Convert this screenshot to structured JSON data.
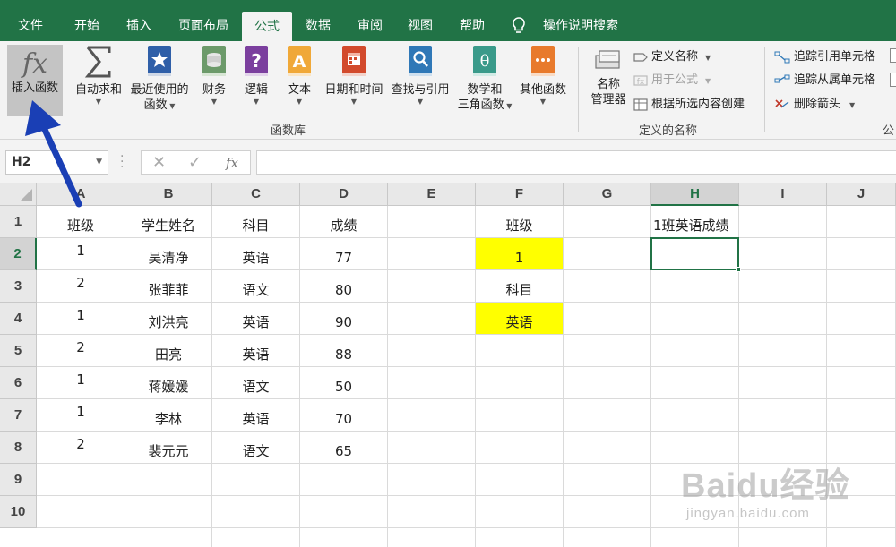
{
  "menu": {
    "tabs": [
      "文件",
      "开始",
      "插入",
      "页面布局",
      "公式",
      "数据",
      "审阅",
      "视图",
      "帮助"
    ],
    "active_tab": "公式",
    "search_label": "操作说明搜索"
  },
  "ribbon": {
    "insert_function": "插入函数",
    "function_library": {
      "buttons": [
        {
          "line1": "自动求和",
          "line2": ""
        },
        {
          "line1": "最近使用的",
          "line2": "函数"
        },
        {
          "line1": "财务",
          "line2": ""
        },
        {
          "line1": "逻辑",
          "line2": ""
        },
        {
          "line1": "文本",
          "line2": ""
        },
        {
          "line1": "日期和时间",
          "line2": ""
        },
        {
          "line1": "查找与引用",
          "line2": ""
        },
        {
          "line1": "数学和",
          "line2": "三角函数"
        },
        {
          "line1": "其他函数",
          "line2": ""
        }
      ],
      "group_label": "函数库"
    },
    "defined_names": {
      "name_manager_line1": "名称",
      "name_manager_line2": "管理器",
      "define_name": "定义名称",
      "use_in_formula": "用于公式",
      "create_from_selection": "根据所选内容创建",
      "group_label": "定义的名称"
    },
    "formula_auditing": {
      "trace_precedents": "追踪引用单元格",
      "trace_dependents": "追踪从属单元格",
      "remove_arrows": "删除箭头",
      "group_label_partial": "公"
    }
  },
  "formula_bar": {
    "name_box": "H2",
    "content": ""
  },
  "grid": {
    "columns": [
      "A",
      "B",
      "C",
      "D",
      "E",
      "F",
      "G",
      "H",
      "I",
      "J"
    ],
    "selected_column": "H",
    "rows": [
      "1",
      "2",
      "3",
      "4",
      "5",
      "6",
      "7",
      "8",
      "9",
      "10"
    ],
    "selected_row": "2",
    "table_headers": [
      "班级",
      "学生姓名",
      "科目",
      "成绩"
    ],
    "table_rows": [
      [
        "1",
        "吴清净",
        "英语",
        "77"
      ],
      [
        "2",
        "张菲菲",
        "语文",
        "80"
      ],
      [
        "1",
        "刘洪亮",
        "英语",
        "90"
      ],
      [
        "2",
        "田亮",
        "英语",
        "88"
      ],
      [
        "1",
        "蒋媛媛",
        "语文",
        "50"
      ],
      [
        "1",
        "李林",
        "英语",
        "70"
      ],
      [
        "2",
        "裴元元",
        "语文",
        "65"
      ]
    ],
    "criteria": {
      "class_label": "班级",
      "class_value": "1",
      "subject_label": "科目",
      "subject_value": "英语"
    },
    "result_label": "1班英语成绩",
    "highlight_color": "#ffff00"
  },
  "watermark": {
    "brand": "Baidu经验",
    "url": "jingyan.baidu.com"
  },
  "colors": {
    "excel_green": "#217346",
    "annotation_arrow": "#1a3fb5"
  }
}
